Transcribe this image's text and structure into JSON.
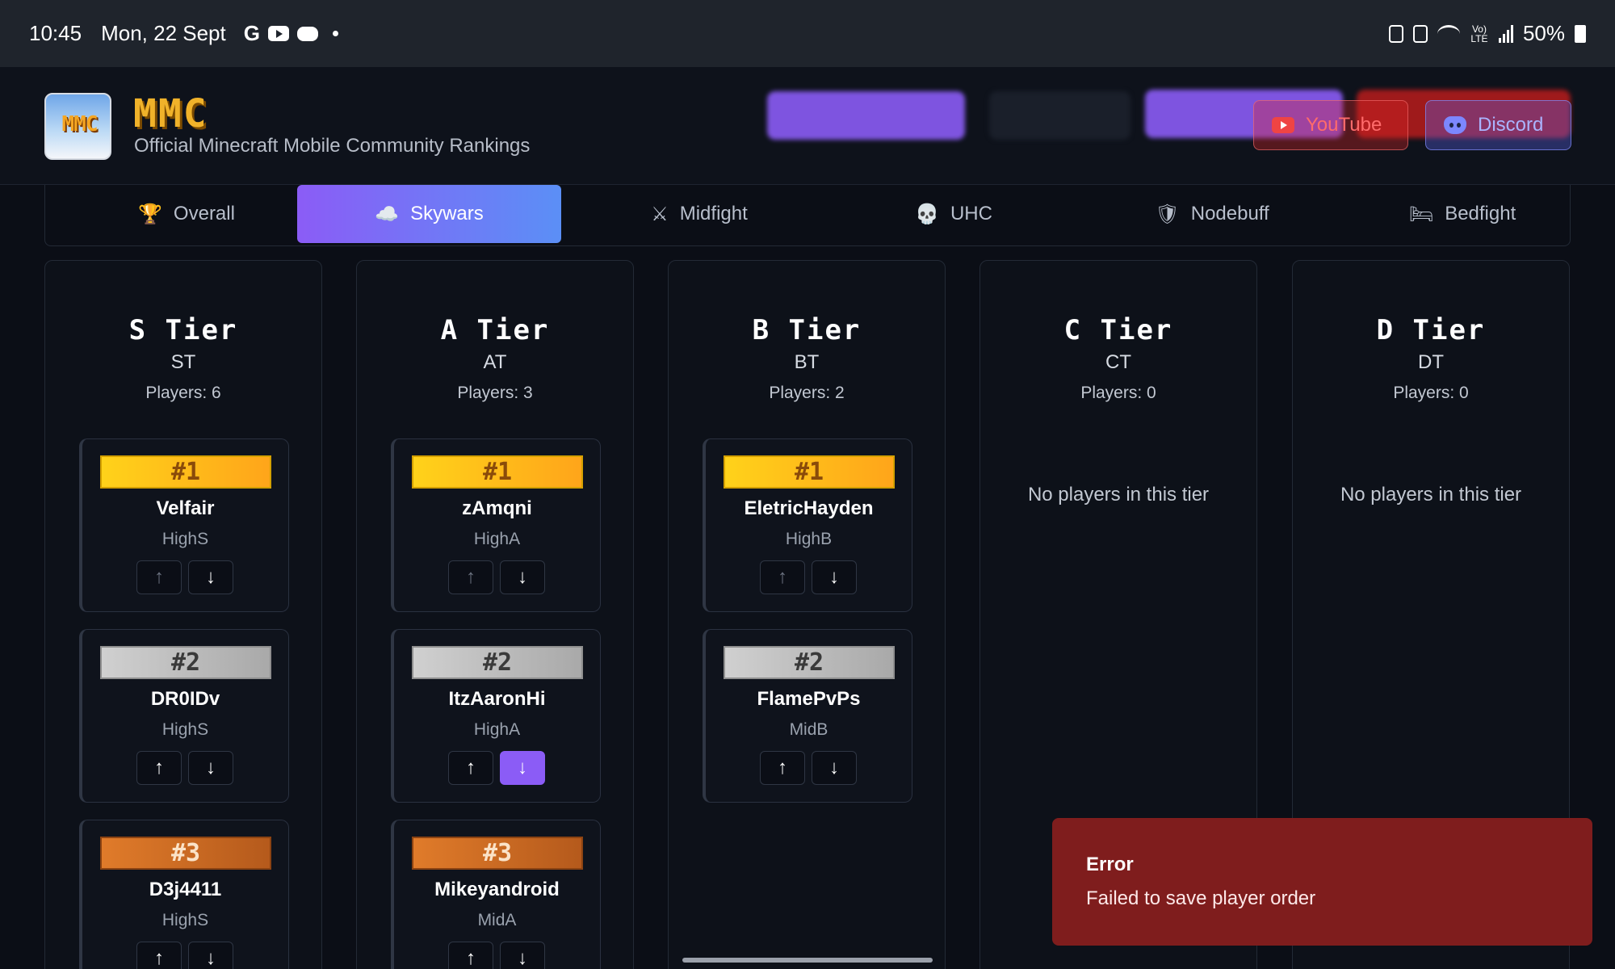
{
  "status_bar": {
    "time": "10:45",
    "date": "Mon, 22 Sept",
    "g": "G",
    "volte": "Vo) LTE",
    "battery": "50%"
  },
  "header": {
    "logo_text": "MMC",
    "title": "MMC",
    "subtitle": "Official Minecraft Mobile Community Rankings",
    "youtube_label": "YouTube",
    "discord_label": "Discord"
  },
  "tabs": [
    {
      "label": "Overall",
      "icon": "🏆"
    },
    {
      "label": "Skywars",
      "icon": "☁️"
    },
    {
      "label": "Midfight",
      "icon": "⚔"
    },
    {
      "label": "UHC",
      "icon": "💀"
    },
    {
      "label": "Nodebuff",
      "icon": "🛡"
    },
    {
      "label": "Bedfight",
      "icon": "🛏"
    }
  ],
  "tiers": [
    {
      "title": "S Tier",
      "code": "ST",
      "count": "Players: 6"
    },
    {
      "title": "A Tier",
      "code": "AT",
      "count": "Players: 3"
    },
    {
      "title": "B Tier",
      "code": "BT",
      "count": "Players: 2"
    },
    {
      "title": "C Tier",
      "code": "CT",
      "count": "Players: 0"
    },
    {
      "title": "D Tier",
      "code": "DT",
      "count": "Players: 0"
    }
  ],
  "empty_text": "No players in this tier",
  "players": {
    "s": [
      {
        "rank": "#1",
        "name": "Velfair",
        "sub": "HighS"
      },
      {
        "rank": "#2",
        "name": "DR0IDv",
        "sub": "HighS"
      },
      {
        "rank": "#3",
        "name": "D3j4411",
        "sub": "HighS"
      }
    ],
    "a": [
      {
        "rank": "#1",
        "name": "zAmqni",
        "sub": "HighA"
      },
      {
        "rank": "#2",
        "name": "ItzAaronHi",
        "sub": "HighA"
      },
      {
        "rank": "#3",
        "name": "Mikeyandroid",
        "sub": "MidA"
      }
    ],
    "b": [
      {
        "rank": "#1",
        "name": "EletricHayden",
        "sub": "HighB"
      },
      {
        "rank": "#2",
        "name": "FlamePvPs",
        "sub": "MidB"
      }
    ]
  },
  "arrows": {
    "up": "↑",
    "down": "↓"
  },
  "toast": {
    "title": "Error",
    "message": "Failed to save player order"
  },
  "colors": {
    "accent_purple": "#8b5cf6",
    "accent_blue": "#5b8ff6",
    "toast_bg": "#7f1d1d",
    "gold": "#ffd21a",
    "silver": "#c0c0c0",
    "bronze": "#cd7f32"
  }
}
